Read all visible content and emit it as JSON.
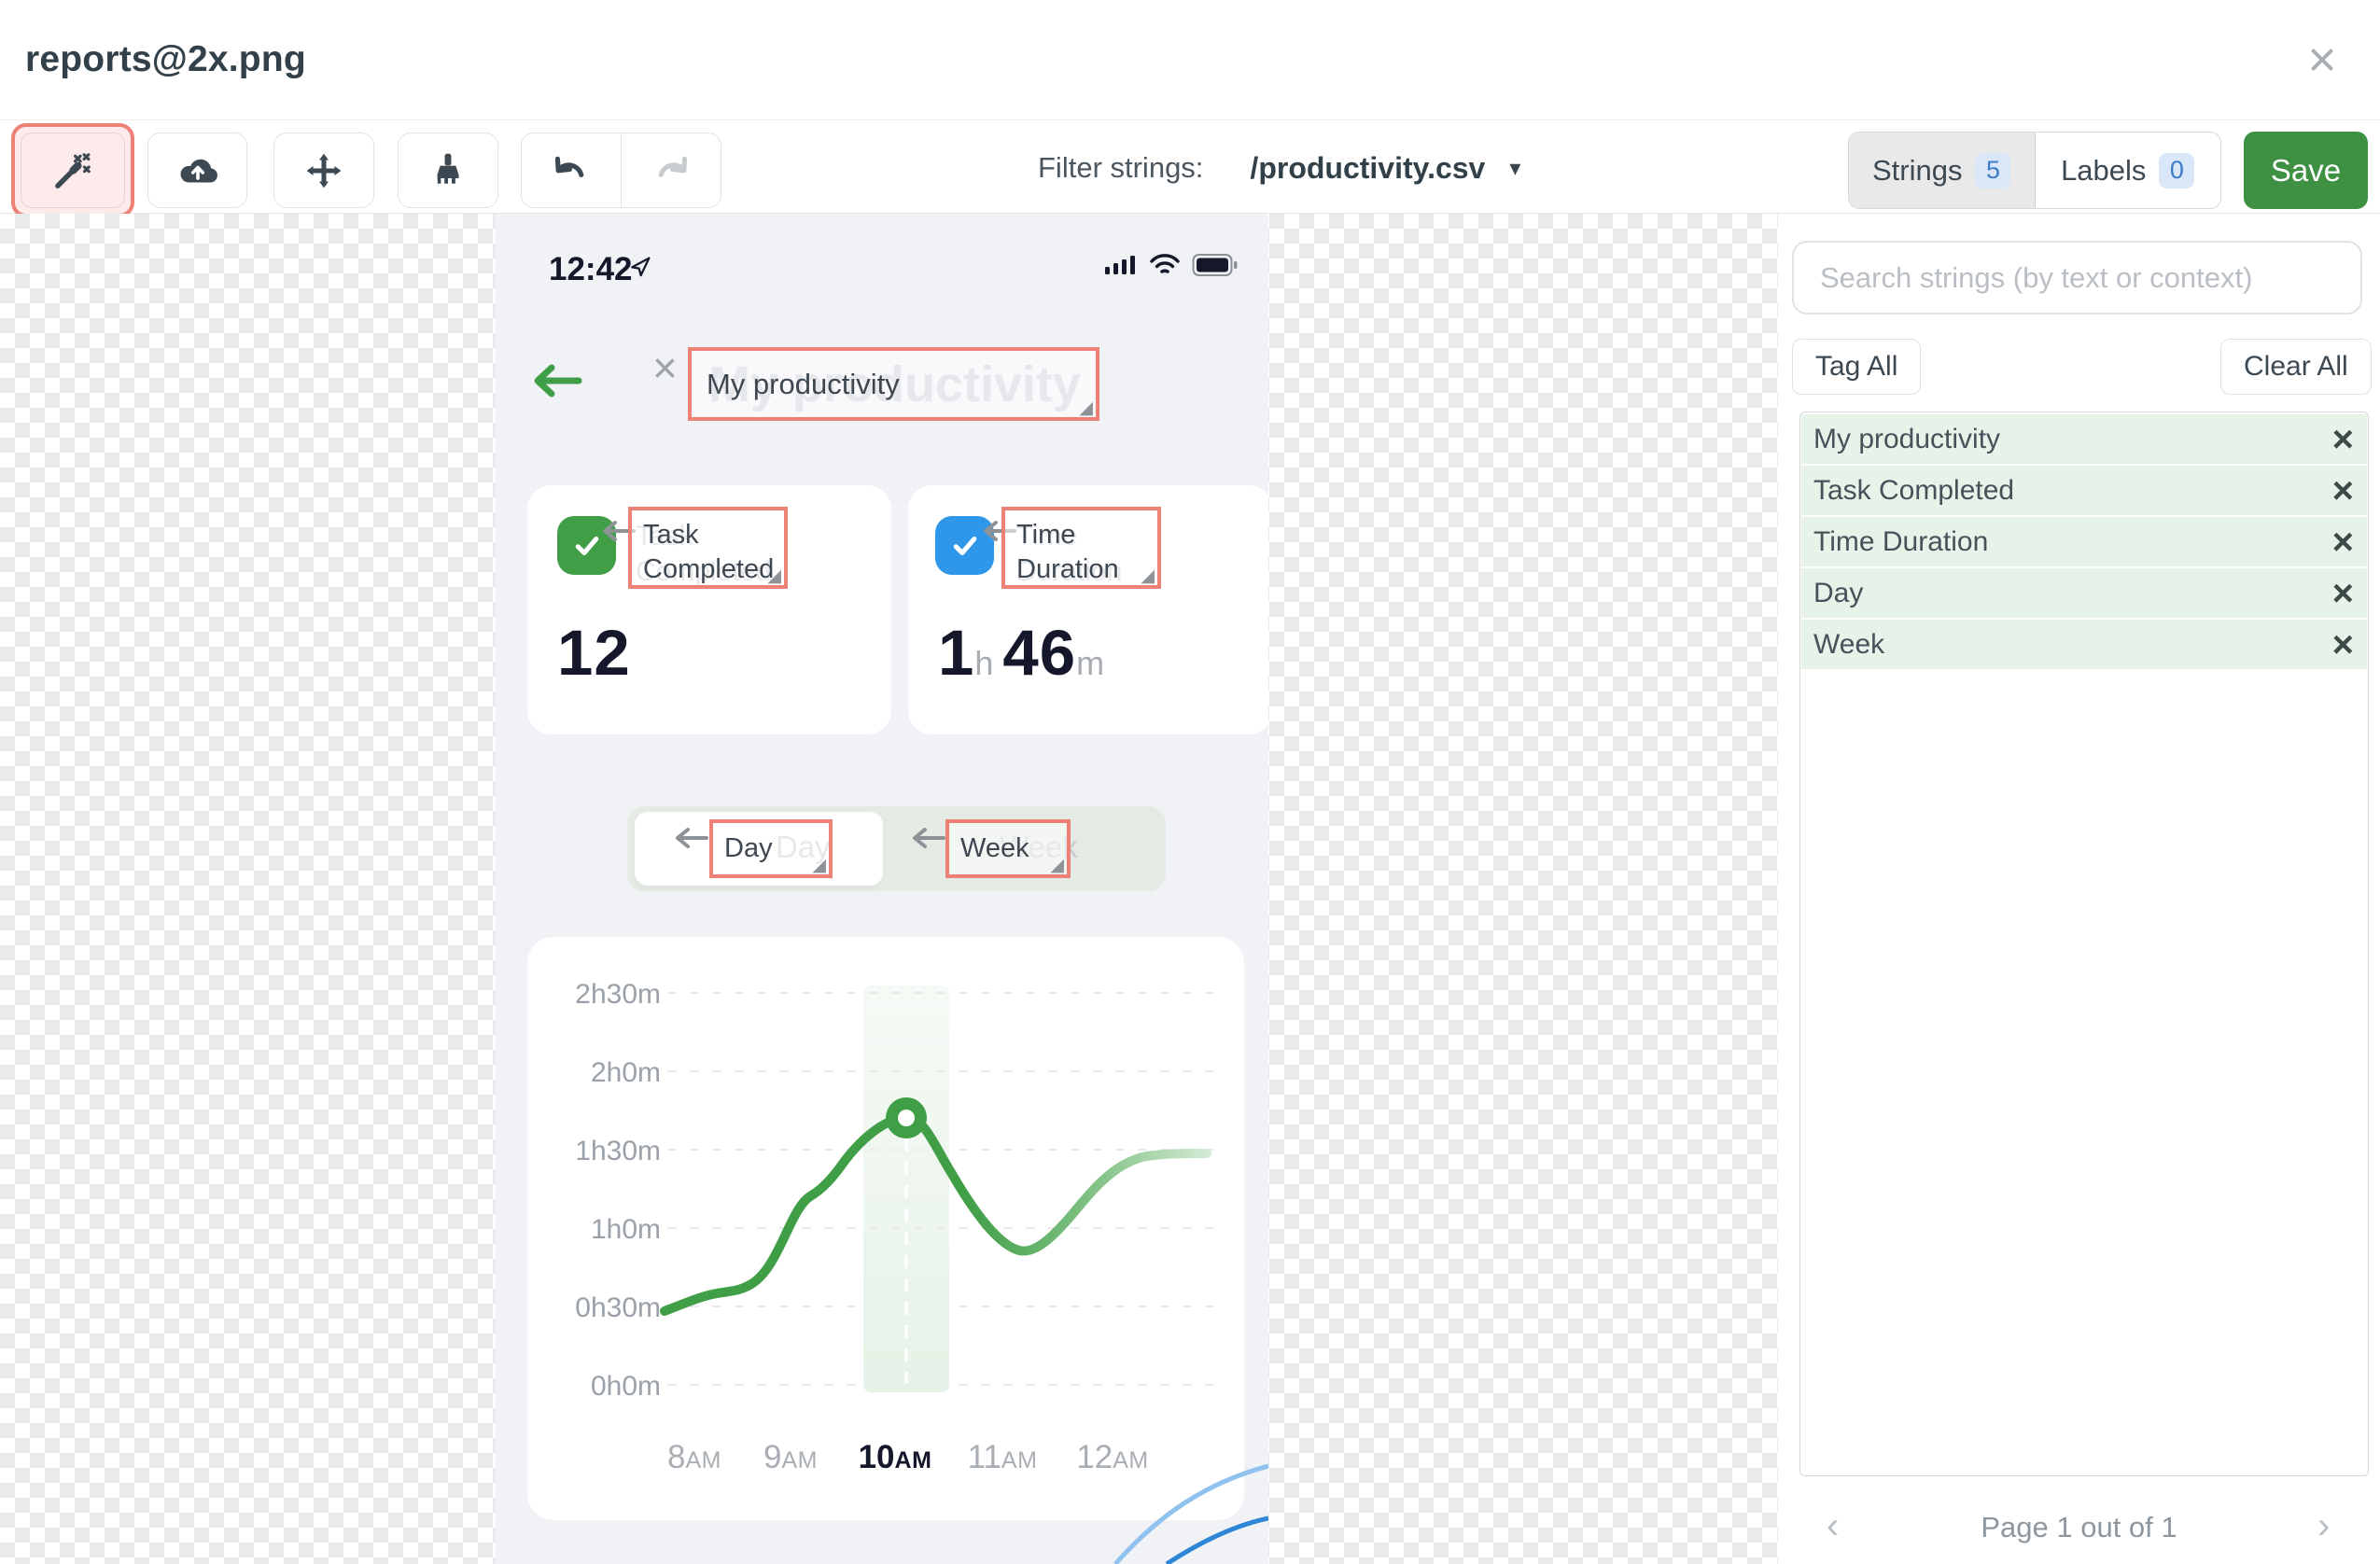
{
  "window": {
    "title": "reports@2x.png",
    "close_glyph": "×"
  },
  "toolbar": {
    "filter_label": "Filter strings:",
    "filter_value": "/productivity.csv",
    "caret_glyph": "▾",
    "strings_tab": "Strings",
    "strings_count": "5",
    "labels_tab": "Labels",
    "labels_count": "0",
    "save_label": "Save"
  },
  "phone": {
    "status_time": "12:42",
    "title_overlay": "My productivity",
    "title_ghost": "My productivity",
    "card_tasks": {
      "line1": "Task",
      "line2": "Completed",
      "ghost1": "Task",
      "ghost2": "Completed",
      "value": "12"
    },
    "card_time": {
      "line1": "Time",
      "line2": "Duration",
      "ghost1": "Time",
      "ghost2": "Duration",
      "value_h": "1",
      "unit_h": "h",
      "value_m": "46",
      "unit_m": "m"
    },
    "toggle": {
      "day": "Day",
      "day_ghost": "Day",
      "week": "Week",
      "week_ghost": "Week"
    },
    "grip_glyph": "◢"
  },
  "chart_data": {
    "type": "line",
    "title": "",
    "x": [
      "8AM",
      "9AM",
      "10AM",
      "11AM",
      "12AM"
    ],
    "x_parts": [
      {
        "num": "8",
        "suffix": "AM"
      },
      {
        "num": "9",
        "suffix": "AM"
      },
      {
        "num": "10",
        "suffix": "AM"
      },
      {
        "num": "11",
        "suffix": "AM"
      },
      {
        "num": "12",
        "suffix": "AM"
      }
    ],
    "values_minutes": [
      30,
      70,
      102,
      54,
      84
    ],
    "y_ticks": [
      "2h30m",
      "2h0m",
      "1h30m",
      "1h0m",
      "0h30m",
      "0h0m"
    ],
    "ylim_minutes": [
      0,
      150
    ],
    "grid": "dashed-horizontal",
    "line_color": "#3f9e46",
    "highlight_x": "10AM",
    "marker": {
      "x": "10AM",
      "value_minutes": 102
    },
    "legend": "none"
  },
  "sidebar": {
    "search_placeholder": "Search strings (by text or context)",
    "tag_all": "Tag All",
    "clear_all": "Clear All",
    "close_glyph": "×",
    "strings": [
      {
        "text": "My productivity"
      },
      {
        "text": "Task Completed"
      },
      {
        "text": "Time Duration"
      },
      {
        "text": "Day"
      },
      {
        "text": "Week"
      }
    ],
    "pagination": {
      "prev": "‹",
      "label": "Page 1 out of 1",
      "next": "›"
    }
  }
}
